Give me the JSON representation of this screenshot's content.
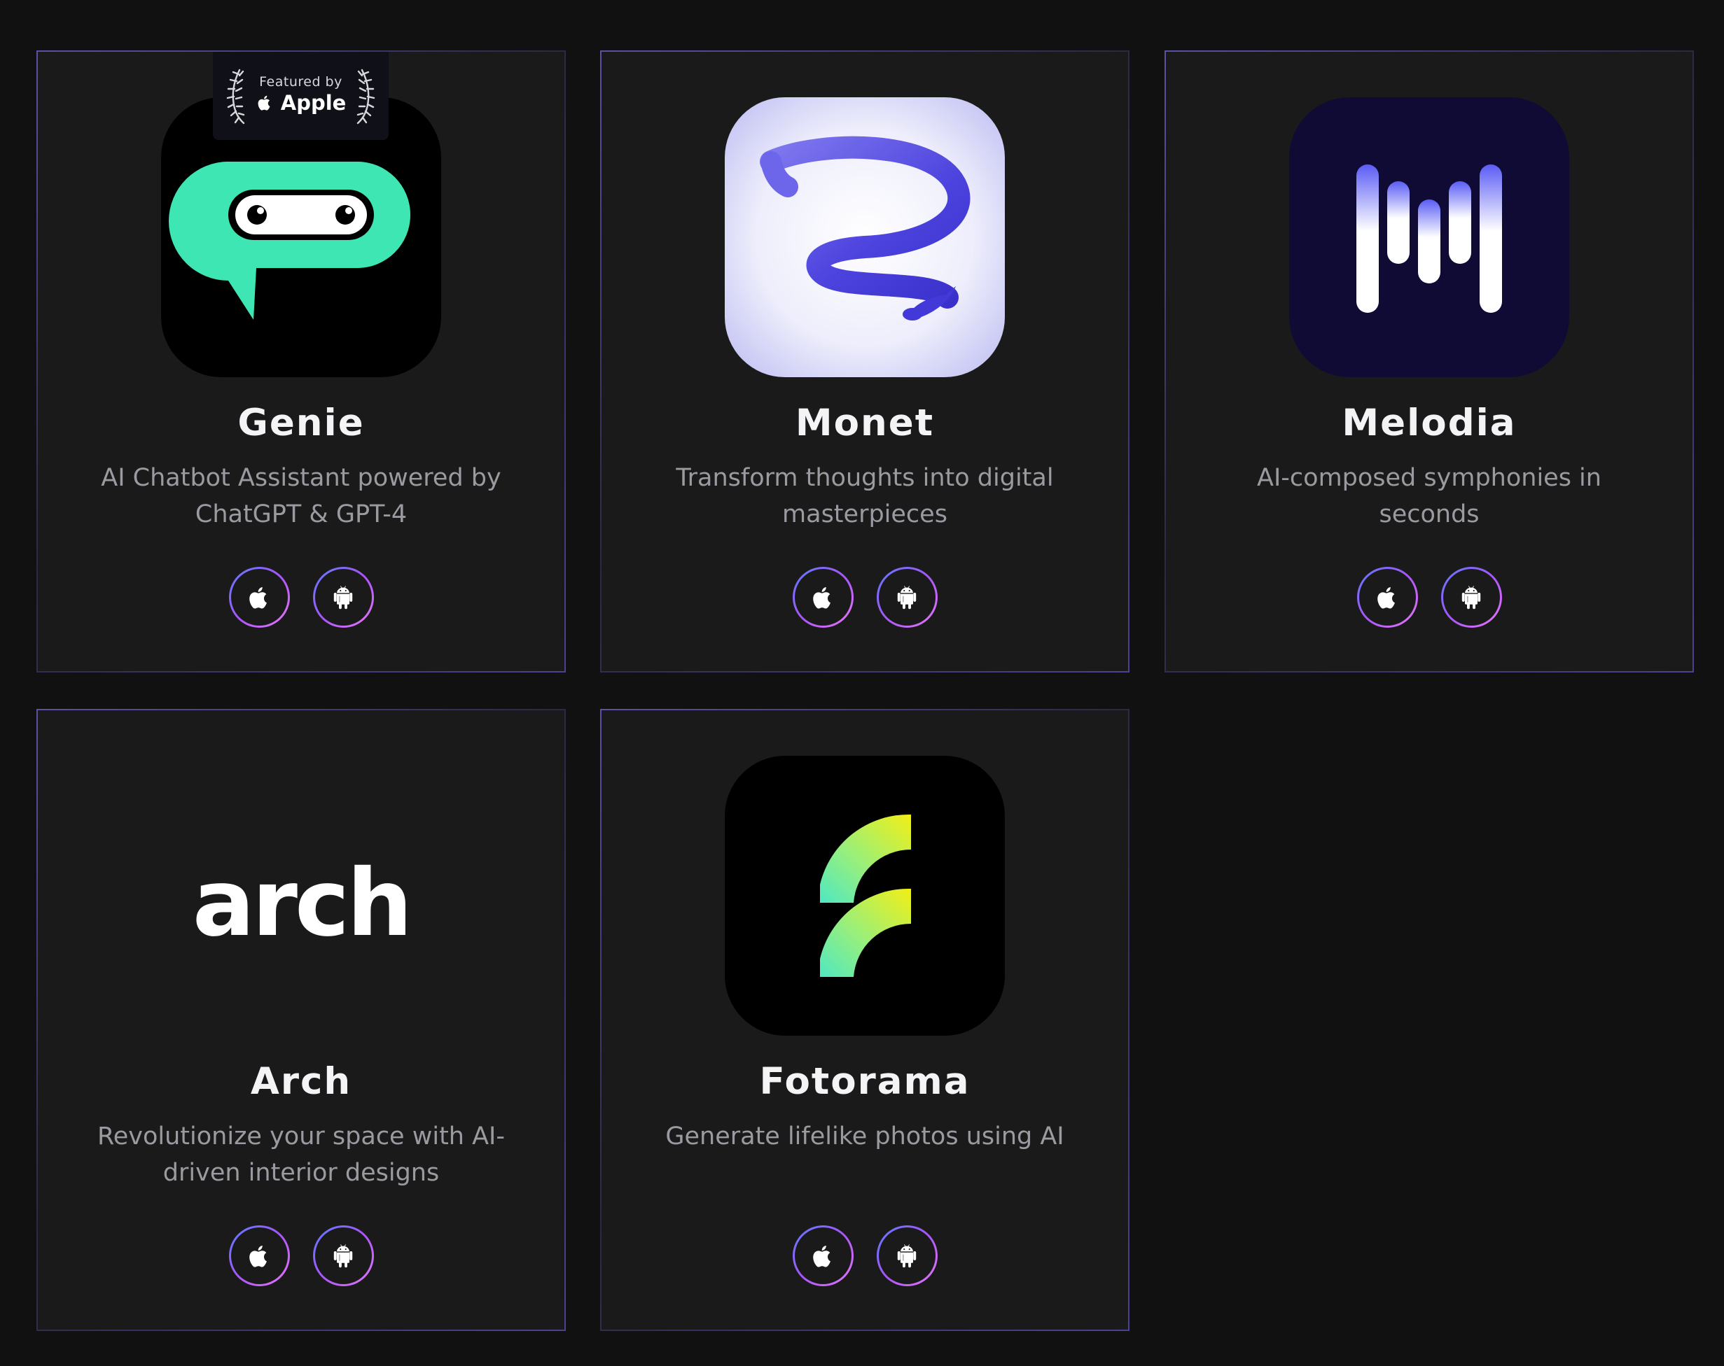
{
  "badge": {
    "line1": "Featured by",
    "line2": "Apple"
  },
  "apps": [
    {
      "name": "Genie",
      "description": "AI Chatbot Assistant powered by ChatGPT & GPT-4"
    },
    {
      "name": "Monet",
      "description": "Transform thoughts into digital masterpieces"
    },
    {
      "name": "Melodia",
      "description": "AI-composed symphonies in seconds"
    },
    {
      "name": "Arch",
      "description": "Revolutionize your space with AI-driven interior designs"
    },
    {
      "name": "Fotorama",
      "description": "Generate lifelike photos using AI"
    }
  ],
  "arch_logo_text": "arch",
  "icons": {
    "ios": "apple-icon",
    "android": "android-icon"
  },
  "colors": {
    "background": "#111112",
    "card": "#1a1a1b",
    "genie_green": "#3ee6b4",
    "monet_purple": "#5a4fe0",
    "melodia_bg": "#100b34",
    "button_ring_start": "#5d7bff",
    "button_ring_end": "#e879f9"
  }
}
